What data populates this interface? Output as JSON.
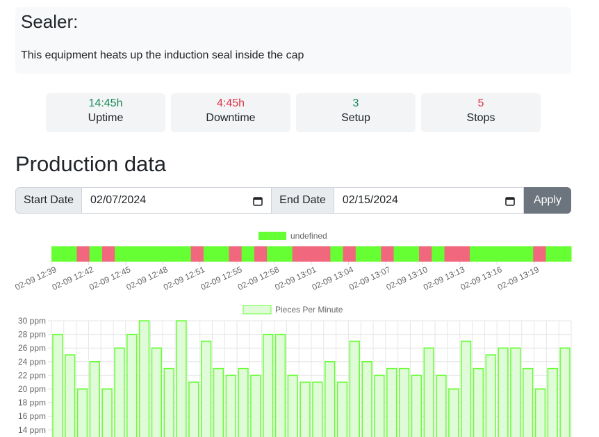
{
  "equipment": {
    "title": "Sealer:",
    "description": "This equipment heats up the induction seal inside the cap"
  },
  "stats": [
    {
      "value": "14:45h",
      "label": "Uptime",
      "color": "#198754"
    },
    {
      "value": "4:45h",
      "label": "Downtime",
      "color": "#dc3545"
    },
    {
      "value": "3",
      "label": "Setup",
      "color": "#198754"
    },
    {
      "value": "5",
      "label": "Stops",
      "color": "#dc3545"
    }
  ],
  "production": {
    "heading": "Production data",
    "start_label": "Start Date",
    "start_value": "02/07/2024",
    "end_label": "End Date",
    "end_value": "02/15/2024",
    "apply_label": "Apply"
  },
  "chart_data": [
    {
      "type": "bar",
      "legend": "undefined",
      "colors": {
        "up": "#66ff33",
        "down": "#f0677e"
      },
      "x_tick_labels": [
        "02-09 12:39",
        "02-09 12:42",
        "02-09 12:45",
        "02-09 12:48",
        "02-09 12:51",
        "02-09 12:55",
        "02-09 12:58",
        "02-09 13:01",
        "02-09 13:04",
        "02-09 13:07",
        "02-09 13:10",
        "02-09 13:13",
        "02-09 13:16",
        "02-09 13:19"
      ],
      "segments": [
        "up",
        "up",
        "down",
        "up",
        "down",
        "up",
        "up",
        "up",
        "up",
        "up",
        "up",
        "down",
        "up",
        "up",
        "down",
        "up",
        "down",
        "up",
        "up",
        "down",
        "down",
        "down",
        "up",
        "down",
        "up",
        "up",
        "down",
        "up",
        "up",
        "down",
        "up",
        "down",
        "down",
        "up",
        "up",
        "up",
        "up",
        "up",
        "down",
        "up",
        "up"
      ]
    },
    {
      "type": "bar",
      "legend": "Pieces Per Minute",
      "color": "#66ff33",
      "ylim": [
        13,
        30
      ],
      "y_ticks": [
        "30 ppm",
        "28 ppm",
        "26 ppm",
        "24 ppm",
        "22 ppm",
        "20 ppm",
        "18 ppm",
        "16 ppm",
        "14 ppm"
      ],
      "values": [
        28,
        25,
        20,
        24,
        20,
        26,
        28,
        30,
        26,
        23,
        30,
        21,
        27,
        23,
        22,
        23,
        22,
        28,
        28,
        22,
        21,
        21,
        24,
        21,
        27,
        24,
        22,
        23,
        23,
        22,
        26,
        22,
        20,
        27,
        23,
        25,
        26,
        26,
        23,
        20,
        23,
        26
      ]
    }
  ]
}
